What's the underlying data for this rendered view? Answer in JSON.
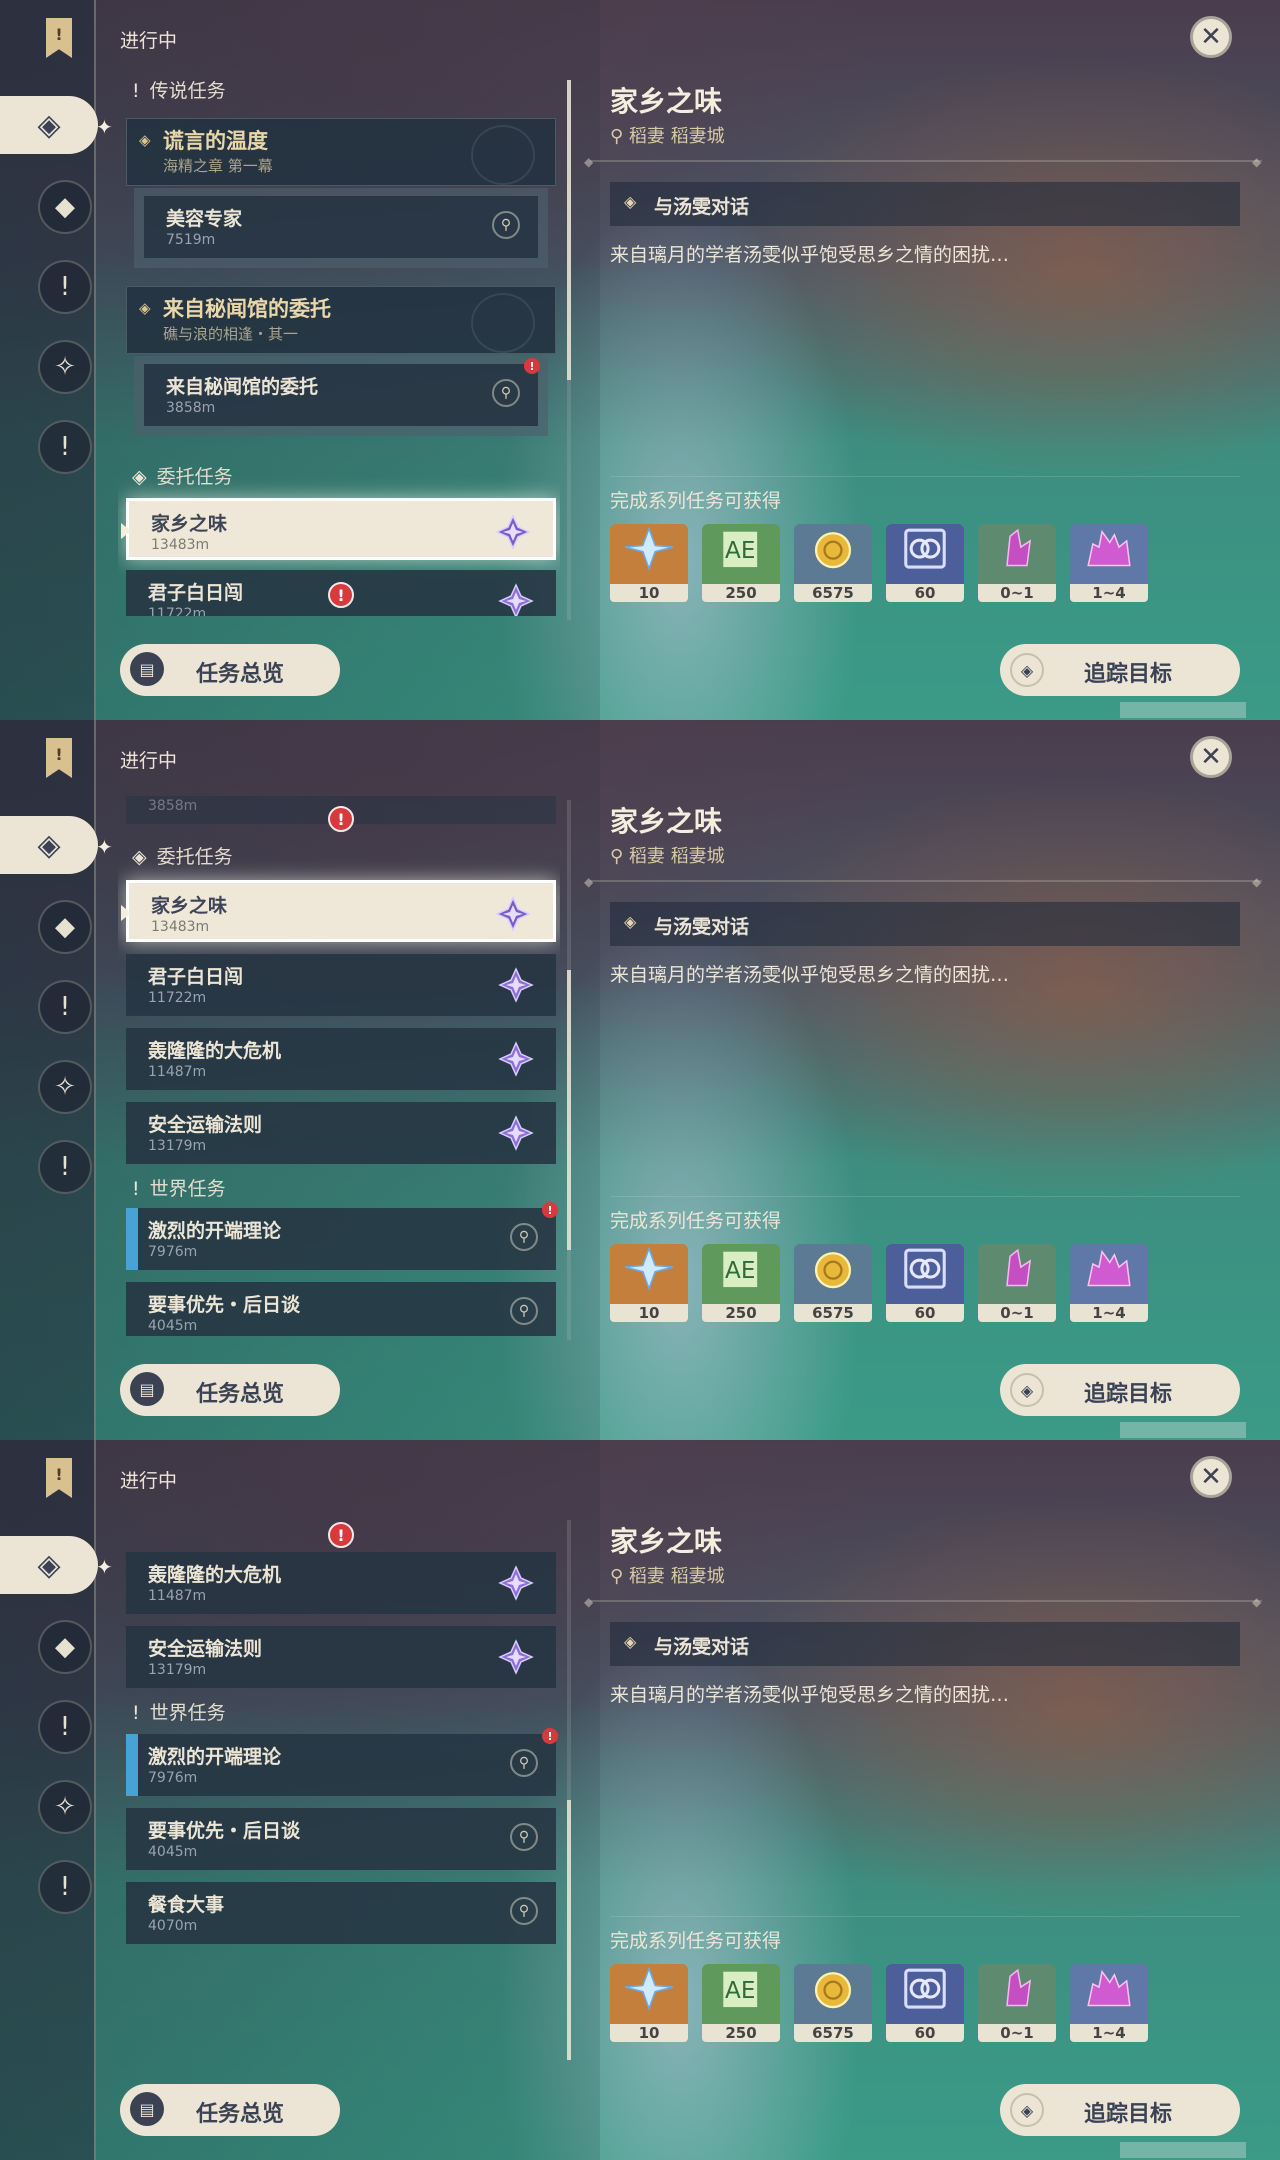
{
  "header": {
    "status": "进行中"
  },
  "rail_flag_glyph": "!",
  "detail": {
    "title": "家乡之味",
    "location": "稻妻 稻妻城",
    "objective": "与汤雯对话",
    "description": "来自璃月的学者汤雯似乎饱受思乡之情的困扰…",
    "rewards_title": "完成系列任务可获得",
    "rewards": [
      {
        "name": "primogem",
        "count": "10",
        "bg": "#c47f3c"
      },
      {
        "name": "adventure-exp",
        "count": "250",
        "bg": "#5f9a5c"
      },
      {
        "name": "mora",
        "count": "6575",
        "bg": "#5d7a95"
      },
      {
        "name": "companionship-exp",
        "count": "60",
        "bg": "#4d5f9a"
      },
      {
        "name": "amethyst-crystal",
        "count": "0~1",
        "bg": "#5e8a70"
      },
      {
        "name": "amethyst-crystal-cluster",
        "count": "1~4",
        "bg": "#5f78a8"
      }
    ]
  },
  "buttons": {
    "overview": "任务总览",
    "track": "追踪目标"
  },
  "sections": {
    "archon": "传说任务",
    "commission": "委托任务",
    "world": "世界任务"
  },
  "quests": {
    "archon1": {
      "title": "谎言的温度",
      "subtitle": "海精之章 第一幕"
    },
    "archon1_step": {
      "title": "美容专家",
      "dist": "7519m"
    },
    "archon2": {
      "title": "来自秘闻馆的委托",
      "subtitle": "礁与浪的相逢・其一"
    },
    "archon2_step": {
      "title": "来自秘闻馆的委托",
      "dist": "3858m"
    },
    "c1": {
      "title": "家乡之味",
      "dist": "13483m"
    },
    "c2": {
      "title": "君子白日闯",
      "dist": "11722m"
    },
    "c3": {
      "title": "轰隆隆的大危机",
      "dist": "11487m"
    },
    "c4": {
      "title": "安全运输法则",
      "dist": "13179m"
    },
    "w1": {
      "title": "激烈的开端理论",
      "dist": "7976m"
    },
    "w2": {
      "title": "要事优先・后日谈",
      "dist": "4045m"
    },
    "w3": {
      "title": "餐食大事",
      "dist": "4070m"
    }
  },
  "colors": {
    "panel": "#263442",
    "accent_cream": "#ece5d6",
    "alert_red": "#d8393c",
    "world_blue": "#47a3d6"
  }
}
